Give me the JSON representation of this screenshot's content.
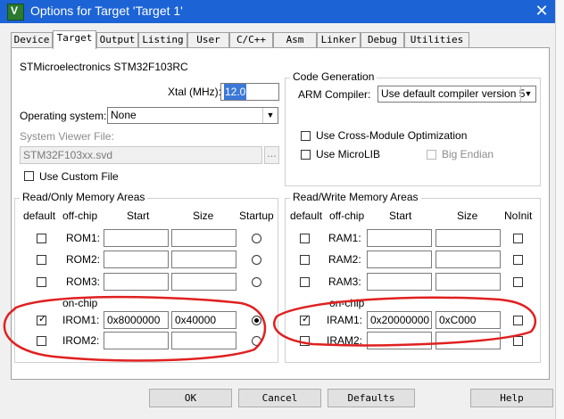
{
  "window": {
    "title": "Options for Target 'Target 1'",
    "close_icon": "✕",
    "app_icon_letter": "V"
  },
  "tabs": [
    {
      "label": "Device"
    },
    {
      "label": "Target"
    },
    {
      "label": "Output"
    },
    {
      "label": "Listing"
    },
    {
      "label": "User"
    },
    {
      "label": "C/C++"
    },
    {
      "label": "Asm"
    },
    {
      "label": "Linker"
    },
    {
      "label": "Debug"
    },
    {
      "label": "Utilities"
    }
  ],
  "active_tab": "Target",
  "device_name": "STMicroelectronics STM32F103RC",
  "xtal": {
    "label": "Xtal (MHz):",
    "value": "12.0"
  },
  "os": {
    "label": "Operating system:",
    "value": "None"
  },
  "svd": {
    "label": "System Viewer File:",
    "value": "STM32F103xx.svd",
    "browse": "..."
  },
  "custom_file": {
    "label": "Use Custom File",
    "checked": false
  },
  "codegen": {
    "title": "Code Generation",
    "compiler_label": "ARM Compiler:",
    "compiler_value": "Use default compiler version 5",
    "cross_module": {
      "label": "Use Cross-Module Optimization",
      "checked": false
    },
    "microlib": {
      "label": "Use MicroLIB",
      "checked": false
    },
    "big_endian": {
      "label": "Big Endian",
      "checked": false
    }
  },
  "rom": {
    "title": "Read/Only Memory Areas",
    "headers": {
      "default": "default",
      "offchip": "off-chip",
      "start": "Start",
      "size": "Size",
      "startup": "Startup"
    },
    "onchip_label": "on-chip",
    "rows": [
      {
        "name": "ROM1:",
        "start": "",
        "size": "",
        "default": false,
        "startup": false
      },
      {
        "name": "ROM2:",
        "start": "",
        "size": "",
        "default": false,
        "startup": false
      },
      {
        "name": "ROM3:",
        "start": "",
        "size": "",
        "default": false,
        "startup": false
      },
      {
        "name": "IROM1:",
        "start": "0x8000000",
        "size": "0x40000",
        "default": true,
        "startup": true
      },
      {
        "name": "IROM2:",
        "start": "",
        "size": "",
        "default": false,
        "startup": false
      }
    ]
  },
  "ram": {
    "title": "Read/Write Memory Areas",
    "headers": {
      "default": "default",
      "offchip": "off-chip",
      "start": "Start",
      "size": "Size",
      "noinit": "NoInit"
    },
    "onchip_label": "on-chip",
    "rows": [
      {
        "name": "RAM1:",
        "start": "",
        "size": "",
        "default": false,
        "noinit": false
      },
      {
        "name": "RAM2:",
        "start": "",
        "size": "",
        "default": false,
        "noinit": false
      },
      {
        "name": "RAM3:",
        "start": "",
        "size": "",
        "default": false,
        "noinit": false
      },
      {
        "name": "IRAM1:",
        "start": "0x20000000",
        "size": "0xC000",
        "default": true,
        "noinit": false
      },
      {
        "name": "IRAM2:",
        "start": "",
        "size": "",
        "default": false,
        "noinit": false
      }
    ]
  },
  "buttons": {
    "ok": "OK",
    "cancel": "Cancel",
    "defaults": "Defaults",
    "help": "Help"
  },
  "colors": {
    "titlebar": "#1c63d6",
    "annotation": "#e02020",
    "selection": "#3c78d8"
  }
}
